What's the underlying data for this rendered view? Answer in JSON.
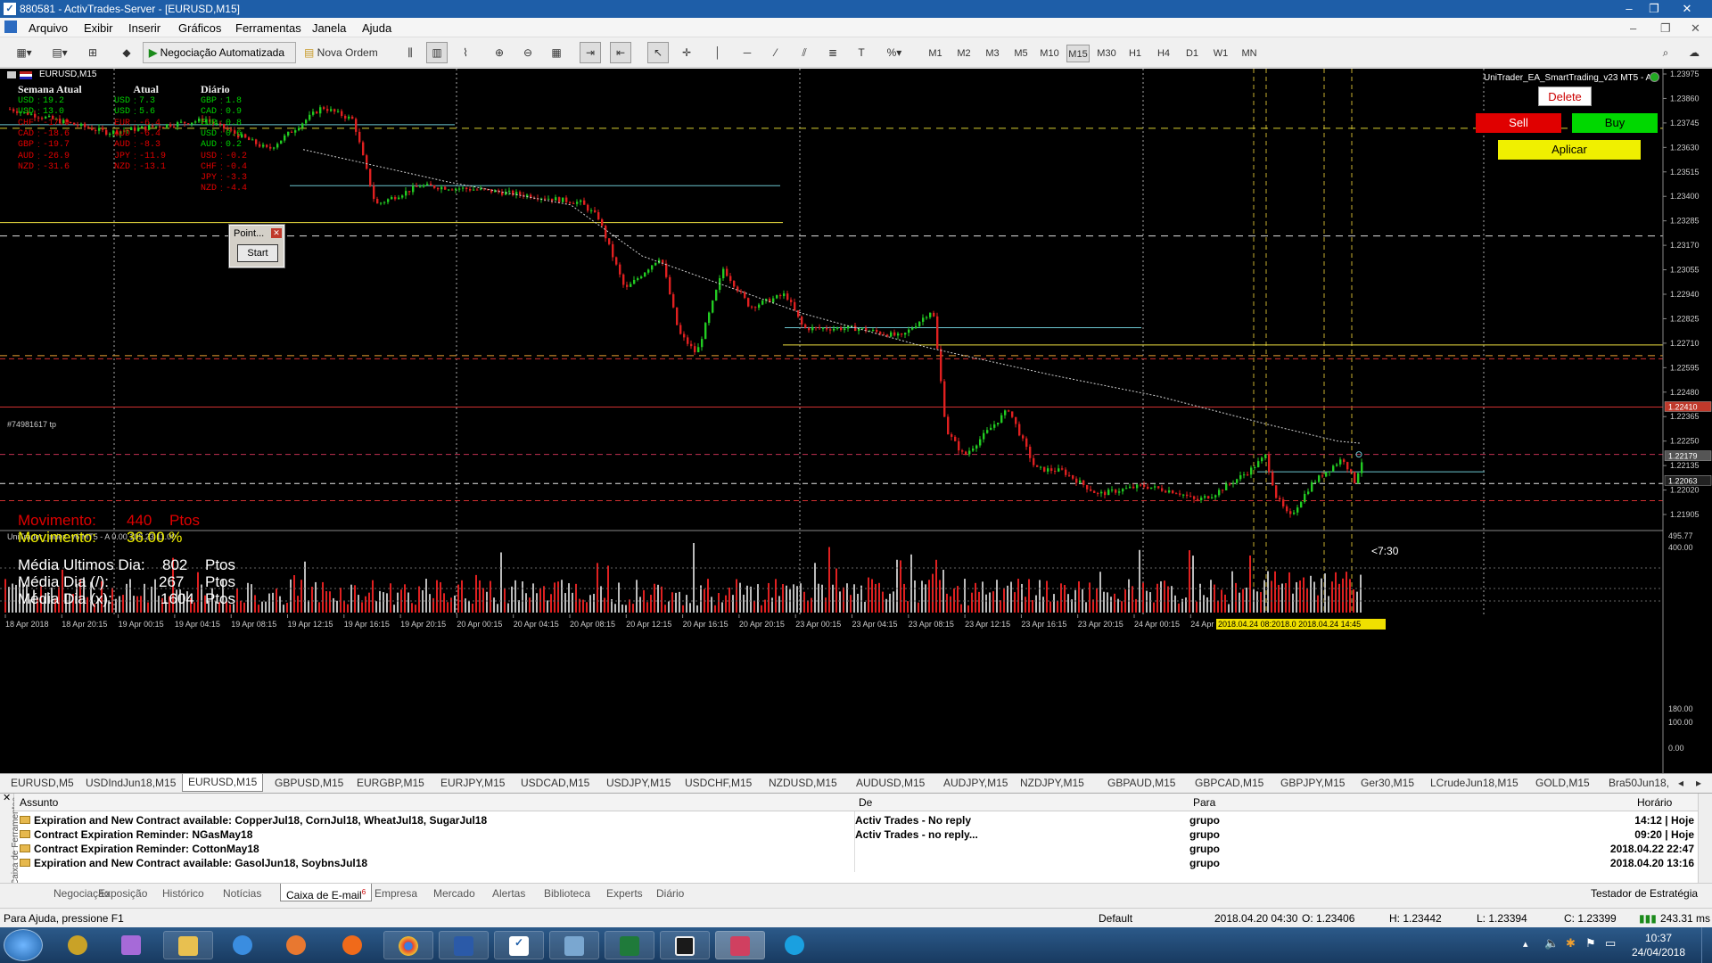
{
  "window": {
    "title": "880581 - ActivTrades-Server - [EURUSD,M15]"
  },
  "menu": [
    "Arquivo",
    "Exibir",
    "Inserir",
    "Gráficos",
    "Ferramentas",
    "Janela",
    "Ajuda"
  ],
  "toolbar": {
    "auto_trading": "Negociação Automatizada",
    "new_order": "Nova Ordem",
    "timeframes": [
      "M1",
      "M2",
      "M3",
      "M5",
      "M10",
      "M15",
      "M30",
      "H1",
      "H4",
      "D1",
      "W1",
      "MN"
    ],
    "active_tf": "M15"
  },
  "chart": {
    "symbol": "EURUSD,M15",
    "ea_label": "UniTrader_EA_SmartTrading_v23 MT5 - A",
    "indicator_label": "UniTrader_Index_v6 MT5 - A 0.00 109.23 11.00",
    "tp_label": "#74981617 tp",
    "strength_headers": [
      "Semana Atual",
      "Semana",
      "Atual",
      "Diário"
    ],
    "strength_cols": [
      [
        [
          "USD",
          "19.2"
        ],
        [
          "USD",
          "13.0"
        ],
        [
          "CHF",
          "-17.0"
        ],
        [
          "CAD",
          "-18.6"
        ],
        [
          "GBP",
          "-19.7"
        ],
        [
          "AUD",
          "-26.9"
        ],
        [
          "NZD",
          "-31.6"
        ]
      ],
      [
        [
          "USD",
          "7.3"
        ],
        [
          "USD",
          "5.6"
        ],
        [
          "EUR",
          "-6.4"
        ],
        [
          "AUD",
          "-6.4"
        ],
        [
          "AUD",
          "-8.3"
        ],
        [
          "JPY",
          "-11.9"
        ],
        [
          "NZD",
          "-13.1"
        ]
      ],
      [
        [
          "GBP",
          "1.8"
        ],
        [
          "CAD",
          "0.9"
        ],
        [
          "EUR",
          "0.8"
        ],
        [
          "USD",
          "0.6"
        ],
        [
          "AUD",
          "0.2"
        ],
        [
          "USD",
          "-0.2"
        ],
        [
          "CHF",
          "-0.4"
        ],
        [
          "JPY",
          "-3.3"
        ],
        [
          "NZD",
          "-4.4"
        ]
      ]
    ],
    "point_dialog": {
      "title": "Point...",
      "button": "Start"
    },
    "buttons": {
      "delete": "Delete",
      "sell": "Sell",
      "buy": "Buy",
      "apply": "Aplicar"
    },
    "stats": {
      "movimento_label": "Movimento:",
      "movimento_pts": "440",
      "pts": "Ptos",
      "movimento_pct_label": "Movimento:",
      "movimento_pct": "36.00 %",
      "media_ultimos_label": "Média Ultimos Dia:",
      "media_ultimos": "802",
      "media_dia_label": "Média Dia (/):",
      "media_dia": "267",
      "media_dia_x_label": "Média Dia (x):",
      "media_dia_x": "1604"
    },
    "timer": "<7:30",
    "price_ticks": [
      "1.23975",
      "1.23860",
      "1.23745",
      "1.23630",
      "1.23515",
      "1.23400",
      "1.23285",
      "1.23170",
      "1.23055",
      "1.22940",
      "1.22825",
      "1.22710",
      "1.22595",
      "1.22480",
      "1.22365",
      "1.22250",
      "1.22135",
      "1.22020",
      "1.21905"
    ],
    "price_tags": [
      {
        "v": "1.22410",
        "color": "#c0392b"
      },
      {
        "v": "1.22179",
        "color": "#555555"
      },
      {
        "v": "1.22063",
        "color": "#222222"
      }
    ],
    "ind_ticks": [
      "495.77",
      "400.00",
      "180.00",
      "100.00",
      "0.00"
    ],
    "time_ticks": [
      "18 Apr 2018",
      "18 Apr 20:15",
      "19 Apr 00:15",
      "19 Apr 04:15",
      "19 Apr 08:15",
      "19 Apr 12:15",
      "19 Apr 16:15",
      "19 Apr 20:15",
      "20 Apr 00:15",
      "20 Apr 04:15",
      "20 Apr 08:15",
      "20 Apr 12:15",
      "20 Apr 16:15",
      "20 Apr 20:15",
      "23 Apr 00:15",
      "23 Apr 04:15",
      "23 Apr 08:15",
      "23 Apr 12:15",
      "23 Apr 16:15",
      "23 Apr 20:15",
      "24 Apr 00:15",
      "24 Apr"
    ],
    "time_highlight": "2018.04.24 08:2018.0 2018.04.24 14:45"
  },
  "symbol_tabs": [
    "EURUSD,M5",
    "USDIndJun18,M15",
    "EURUSD,M15",
    "GBPUSD,M15",
    "EURGBP,M15",
    "EURJPY,M15",
    "USDCAD,M15",
    "USDJPY,M15",
    "USDCHF,M15",
    "NZDUSD,M15",
    "AUDUSD,M15",
    "AUDJPY,M15",
    "NZDJPY,M15",
    "GBPAUD,M15",
    "GBPCAD,M15",
    "GBPJPY,M15",
    "Ger30,M15",
    "LCrudeJun18,M15",
    "GOLD,M15",
    "Bra50Jun18,"
  ],
  "active_symbol_tab": "EURUSD,M15",
  "mailbox": {
    "side_label": "Caixa de Ferramentas",
    "headers": {
      "assunto": "Assunto",
      "de": "De",
      "para": "Para",
      "horario": "Horário"
    },
    "rows": [
      {
        "assunto": "Expiration and New Contract available: CopperJul18, CornJul18, WheatJul18, SugarJul18",
        "de": "Activ Trades - No reply",
        "para": "grupo",
        "horario": "14:12 | Hoje"
      },
      {
        "assunto": "Contract Expiration Reminder: NGasMay18",
        "de": "Activ Trades - no reply...",
        "para": "grupo",
        "horario": "09:20 | Hoje"
      },
      {
        "assunto": "Contract Expiration Reminder: CottonMay18",
        "de": "",
        "para": "grupo",
        "horario": "2018.04.22 22:47"
      },
      {
        "assunto": "Expiration and New Contract available: GasolJun18, SoybnsJul18",
        "de": "",
        "para": "grupo",
        "horario": "2018.04.20 13:16"
      }
    ]
  },
  "bottom_tabs": [
    "Negociação",
    "Exposição",
    "Histórico",
    "Notícias",
    "Caixa de E-mail",
    "Empresa",
    "Mercado",
    "Alertas",
    "Biblioteca",
    "Experts",
    "Diário"
  ],
  "mail_badge": "6",
  "active_bottom_tab": "Caixa de E-mail",
  "strategy_tester": "Testador de Estratégia",
  "status": {
    "help": "Para Ajuda, pressione F1",
    "profile": "Default",
    "datetime": "2018.04.20 04:30",
    "open": "O: 1.23406",
    "high": "H: 1.23442",
    "low": "L: 1.23394",
    "close": "C: 1.23399",
    "ping": "243.31 ms"
  },
  "clock": {
    "time": "10:37",
    "date": "24/04/2018"
  }
}
